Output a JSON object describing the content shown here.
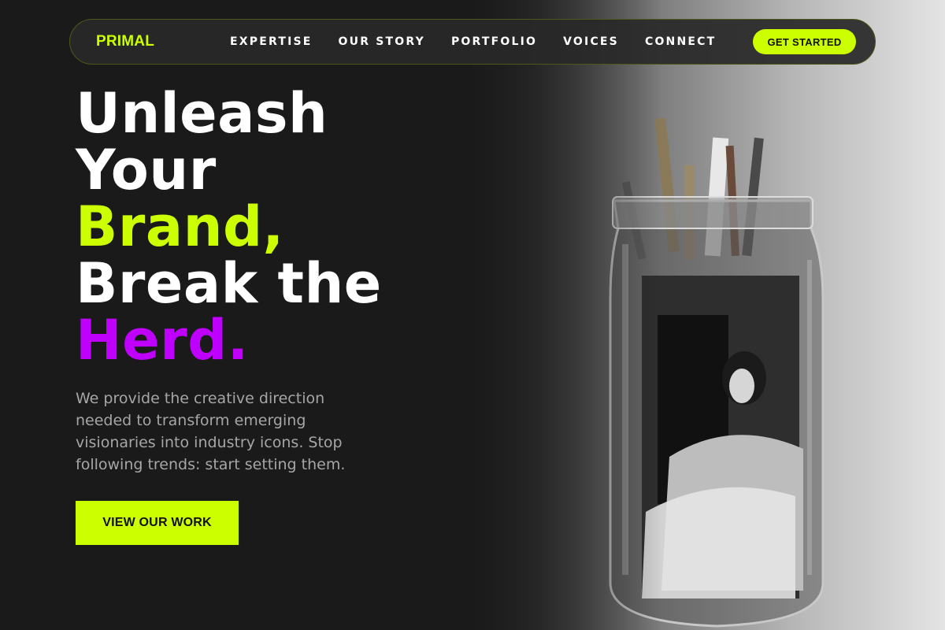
{
  "nav": {
    "logo": "PRIMAL",
    "links": [
      "EXPERTISE",
      "OUR STORY",
      "PORTFOLIO",
      "VOICES",
      "CONNECT"
    ],
    "cta_label": "GET STARTED"
  },
  "hero": {
    "headline": {
      "line1": "Unleash",
      "line2": "Your",
      "line3": "Brand,",
      "line4": "Break the",
      "line5": "Herd."
    },
    "description": "We provide the creative direction needed to transform emerging visionaries into industry icons. Stop following trends: start setting them.",
    "cta_label": "VIEW OUR WORK"
  },
  "colors": {
    "background": "#1a1a1a",
    "accent_green": "#ccff00",
    "accent_purple": "#c000ff",
    "text_muted": "#a6a6a6"
  },
  "image": {
    "subject": "glass-jar-with-paintbrushes-photo"
  }
}
